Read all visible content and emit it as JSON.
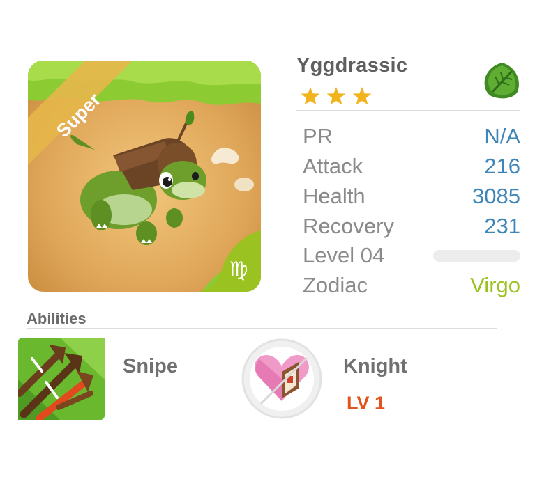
{
  "monster": {
    "name": "Yggdrassic",
    "stars": 3,
    "rarity": "Super",
    "element_icon": "leaf-element-icon",
    "zodiac_icon": "virgo-symbol-icon",
    "zodiac_symbol": "♍"
  },
  "stats": {
    "pr": {
      "label": "PR",
      "value": "N/A"
    },
    "attack": {
      "label": "Attack",
      "value": "216"
    },
    "health": {
      "label": "Health",
      "value": "3085"
    },
    "recovery": {
      "label": "Recovery",
      "value": "231"
    },
    "level": {
      "label": "Level 04",
      "progress": 0.0
    },
    "zodiac": {
      "label": "Zodiac",
      "value": "Virgo"
    }
  },
  "abilities": {
    "title": "Abilities",
    "items": [
      {
        "name": "Snipe",
        "icon": "arrows-icon"
      },
      {
        "name": "Knight",
        "icon": "heart-shield-icon",
        "level": "LV 1"
      }
    ]
  },
  "colors": {
    "stat_value": "#3e86b8",
    "zodiac_value": "#9ac220",
    "ability_level": "#e2541b",
    "rarity_ribbon": "#e5b64a",
    "element_leaf": "#4e9a2a"
  }
}
